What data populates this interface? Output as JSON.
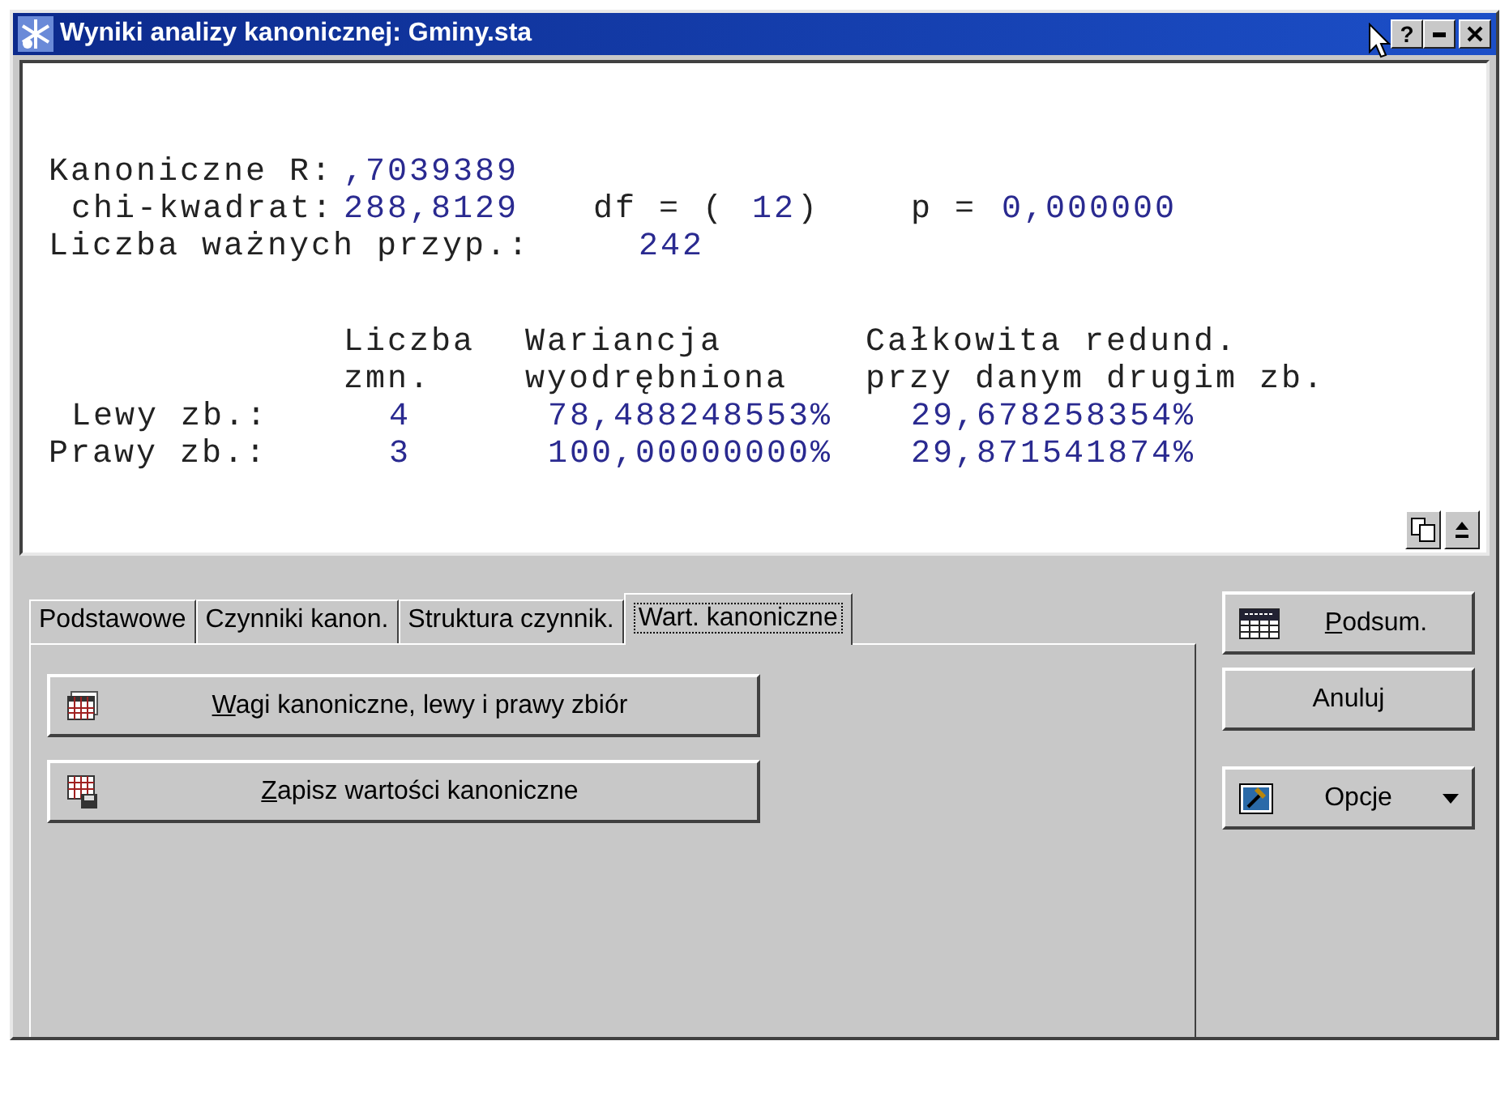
{
  "window": {
    "title": "Wyniki analizy kanonicznej: Gminy.sta",
    "help_label": "?"
  },
  "results": {
    "lines": [
      [
        {
          "kind": "label",
          "text": "Kanoniczne R:"
        },
        {
          "kind": "value",
          "text": ",7039389"
        }
      ],
      [
        {
          "kind": "label",
          "text": "chi-kwadrat:"
        },
        {
          "kind": "value",
          "text": "288,8129"
        },
        {
          "kind": "label",
          "text": "df = ("
        },
        {
          "kind": "value",
          "text": "12"
        },
        {
          "kind": "label",
          "text": ")"
        },
        {
          "kind": "label",
          "text": "p ="
        },
        {
          "kind": "value",
          "text": "0,000000"
        }
      ],
      [
        {
          "kind": "label",
          "text": "Liczba ważnych przyp.:"
        },
        {
          "kind": "value",
          "text": "242"
        }
      ]
    ],
    "table": {
      "columns": [
        {
          "heading_lines": [
            "Liczba",
            "zmn."
          ]
        },
        {
          "heading_lines": [
            "Wariancja",
            "wyodrębniona"
          ]
        },
        {
          "heading_lines": [
            "Całkowita redund.",
            "przy danym drugim zb."
          ]
        }
      ],
      "rows": [
        {
          "label": "Lewy zb.:",
          "cells": [
            "4",
            "78,488248553%",
            "29,678258354%"
          ]
        },
        {
          "label": "Prawy zb.:",
          "cells": [
            "3",
            "100,00000000%",
            "29,871541874%"
          ]
        }
      ]
    }
  },
  "tabs": [
    {
      "label": "Podstawowe",
      "selected": false
    },
    {
      "label": "Czynniki kanon.",
      "selected": false
    },
    {
      "label": "Struktura czynnik.",
      "selected": false
    },
    {
      "label": "Wart. kanoniczne",
      "selected": true
    }
  ],
  "actions": [
    {
      "label": "Wagi kanoniczne, lewy i prawy zbiór",
      "underline_first": true
    },
    {
      "label": "Zapisz wartości kanoniczne",
      "underline_first": true
    }
  ],
  "side_buttons": [
    {
      "label": "Podsum.",
      "underline_first": true,
      "dropdown": false
    },
    {
      "label": "Anuluj",
      "underline_first": false,
      "dropdown": false
    },
    {
      "label": "Opcje",
      "underline_first": false,
      "dropdown": true
    }
  ]
}
